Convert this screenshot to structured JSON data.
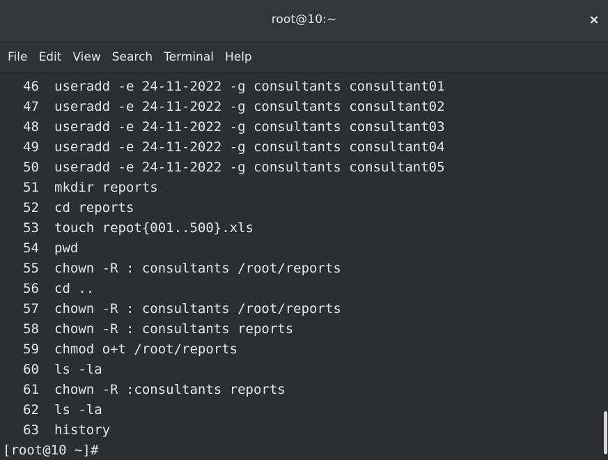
{
  "window": {
    "title": "root@10:~",
    "close_label": "×"
  },
  "menu": {
    "items": [
      {
        "label": "File"
      },
      {
        "label": "Edit"
      },
      {
        "label": "View"
      },
      {
        "label": "Search"
      },
      {
        "label": "Terminal"
      },
      {
        "label": "Help"
      }
    ]
  },
  "history": [
    {
      "num": "46",
      "cmd": "useradd -e 24-11-2022 -g consultants consultant01"
    },
    {
      "num": "47",
      "cmd": "useradd -e 24-11-2022 -g consultants consultant02"
    },
    {
      "num": "48",
      "cmd": "useradd -e 24-11-2022 -g consultants consultant03"
    },
    {
      "num": "49",
      "cmd": "useradd -e 24-11-2022 -g consultants consultant04"
    },
    {
      "num": "50",
      "cmd": "useradd -e 24-11-2022 -g consultants consultant05"
    },
    {
      "num": "51",
      "cmd": "mkdir reports"
    },
    {
      "num": "52",
      "cmd": "cd reports"
    },
    {
      "num": "53",
      "cmd": "touch repot{001..500}.xls"
    },
    {
      "num": "54",
      "cmd": "pwd"
    },
    {
      "num": "55",
      "cmd": "chown -R : consultants /root/reports"
    },
    {
      "num": "56",
      "cmd": "cd .."
    },
    {
      "num": "57",
      "cmd": "chown -R : consultants /root/reports"
    },
    {
      "num": "58",
      "cmd": "chown -R : consultants reports"
    },
    {
      "num": "59",
      "cmd": "chmod o+t /root/reports"
    },
    {
      "num": "60",
      "cmd": "ls -la"
    },
    {
      "num": "61",
      "cmd": "chown -R :consultants reports"
    },
    {
      "num": "62",
      "cmd": "ls -la"
    },
    {
      "num": "63",
      "cmd": "history"
    }
  ],
  "prompt": "[root@10 ~]#",
  "colors": {
    "background": "#2b2f31",
    "foreground": "#e5e5e5",
    "titlebar": "#33373a"
  }
}
